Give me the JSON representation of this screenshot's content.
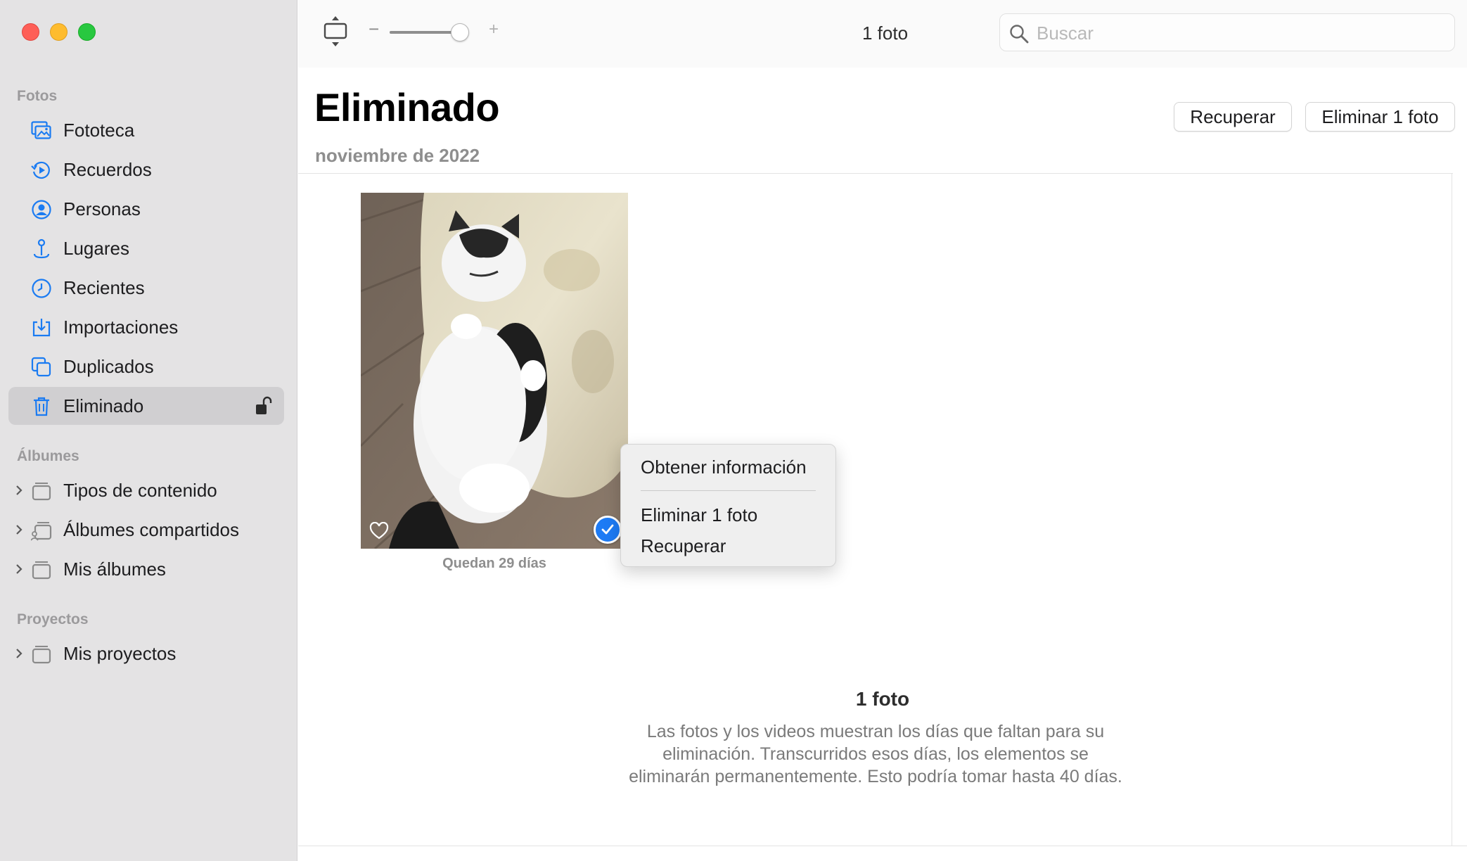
{
  "window": {
    "controls": {
      "close": "#fe5f57",
      "minimize": "#febc2e",
      "zoom": "#28c840"
    }
  },
  "sidebar": {
    "sections": {
      "photos": "Fotos",
      "albums": "Álbumes",
      "projects": "Proyectos"
    },
    "items": [
      {
        "label": "Fototeca",
        "icon": "photo-library-icon"
      },
      {
        "label": "Recuerdos",
        "icon": "memories-icon"
      },
      {
        "label": "Personas",
        "icon": "people-icon"
      },
      {
        "label": "Lugares",
        "icon": "places-icon"
      },
      {
        "label": "Recientes",
        "icon": "clock-icon"
      },
      {
        "label": "Importaciones",
        "icon": "import-icon"
      },
      {
        "label": "Duplicados",
        "icon": "duplicates-icon"
      },
      {
        "label": "Eliminado",
        "icon": "trash-icon",
        "selected": true
      }
    ],
    "albums": [
      {
        "label": "Tipos de contenido",
        "icon": "album-stack-icon"
      },
      {
        "label": "Álbumes compartidos",
        "icon": "shared-album-icon"
      },
      {
        "label": "Mis álbumes",
        "icon": "album-stack-icon"
      }
    ],
    "projects": [
      {
        "label": "Mis proyectos",
        "icon": "album-stack-icon"
      }
    ]
  },
  "toolbar": {
    "zoom_minus": "−",
    "zoom_plus": "+",
    "zoom_level": 0.8,
    "count": "1 foto",
    "search_placeholder": "Buscar"
  },
  "header": {
    "title": "Eliminado",
    "subtitle": "noviembre de 2022",
    "recover_button": "Recuperar",
    "delete_button": "Eliminar 1 foto"
  },
  "photo": {
    "caption": "Quedan 29 días",
    "selected": true
  },
  "context_menu": {
    "items": [
      "Obtener información",
      "Eliminar 1 foto",
      "Recuperar"
    ]
  },
  "footer": {
    "title": "1 foto",
    "text": "Las fotos y los videos muestran los días que faltan para su eliminación. Transcurridos esos días, los elementos se eliminarán permanentemente. Esto podría tomar hasta 40 días."
  },
  "colors": {
    "accent": "#1d7bf5",
    "sidebar_bg": "#e4e3e4",
    "selected_bg": "#d0cfd1"
  }
}
